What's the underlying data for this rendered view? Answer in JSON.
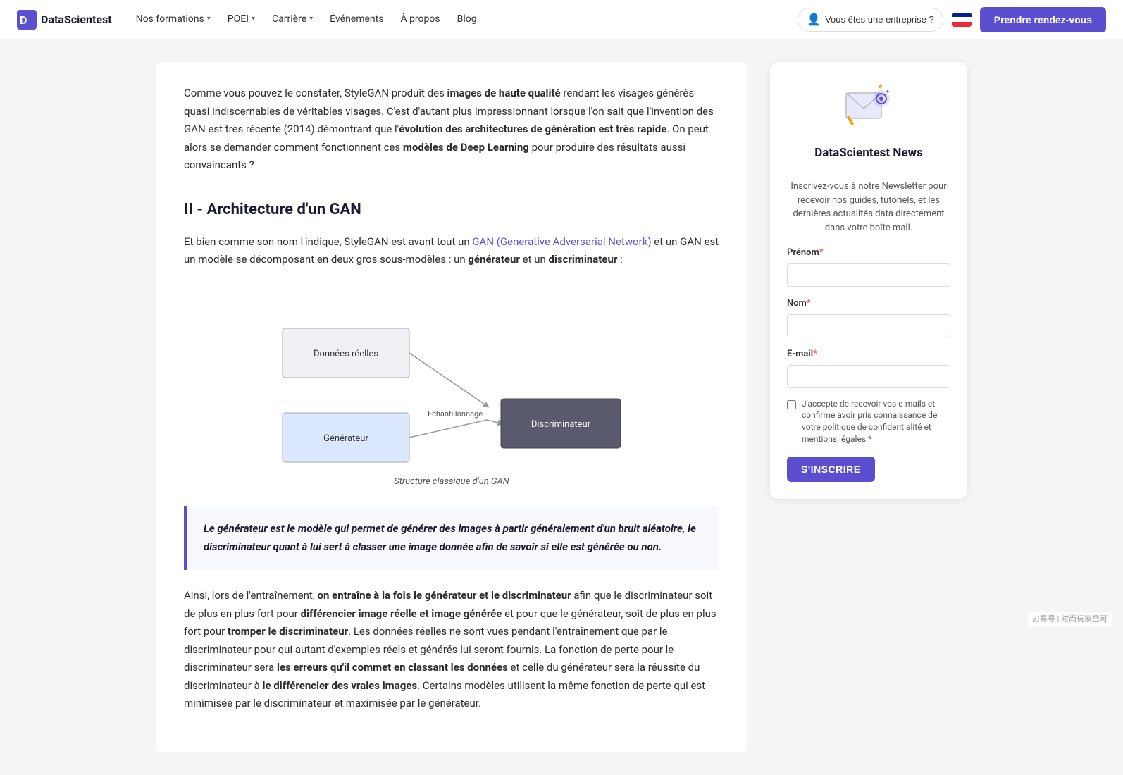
{
  "navbar": {
    "logo_text": "DataScientest",
    "nav_items": [
      {
        "label": "Nos formations",
        "has_dropdown": true
      },
      {
        "label": "POEI",
        "has_dropdown": true
      },
      {
        "label": "Carrière",
        "has_dropdown": true
      },
      {
        "label": "Événements",
        "has_dropdown": false
      },
      {
        "label": "À propos",
        "has_dropdown": false
      },
      {
        "label": "Blog",
        "has_dropdown": false
      }
    ],
    "enterprise_label": "Vous êtes une entreprise ?",
    "cta_label": "Prendre rendez-vous"
  },
  "article": {
    "intro_paragraph": "Comme vous pouvez le constater, StyleGAN produit des images de haute qualité rendant les visages générés quasi indiscernables de véritables visages. C'est d'autant plus impressionnant lorsque l'on sait que l'invention des GAN est très récente (2014) démontrant que l'évolution des architectures de génération est très rapide. On peut alors se demander comment fonctionnent ces modèles de Deep Learning pour produire des résultats aussi convaincants ?",
    "section_heading": "II - Architecture d'un GAN",
    "section_intro": "Et bien comme son nom l'indique, StyleGAN est avant tout un GAN (Generative Adversarial Network) et un GAN est un modèle se décomposant en deux gros sous-modèles : un générateur et un discriminateur :",
    "gan_link_text": "GAN (Generative Adversarial Network)",
    "diagram_caption": "Structure classique d'un GAN",
    "diagram_nodes": {
      "donnees_reelles": "Données réelles",
      "generateur": "Générateur",
      "echantillonnage": "Echantillonnage",
      "discriminateur": "Discriminateur"
    },
    "highlight_text": "Le générateur est le modèle qui permet de générer des images à partir généralement d'un bruit aléatoire, le discriminateur quant à lui sert à classer une image donnée afin de savoir si elle est générée ou non.",
    "body_paragraph": "Ainsi, lors de l'entraînement, on entraîne à la fois le générateur et le discriminateur afin que le discriminateur soit de plus en plus fort pour différencier image réelle et image générée et pour que le générateur, soit de plus en plus fort pour tromper le discriminateur. Les données réelles ne sont vues pendant l'entraînement que par le discriminateur pour qui autant d'exemples réels et générés lui seront fournis. La fonction de perte pour le discriminateur sera les erreurs qu'il commet en classant les données et celle du générateur sera la réussite du discriminateur à le différencier des vraies images. Certains modèles utilisent la même fonction de perte qui est minimisée par le discriminateur et maximisée par le générateur."
  },
  "sidebar": {
    "newsletter_title": "DataScientest News",
    "newsletter_desc": "Inscrivez-vous à notre Newsletter pour recevoir nos guides, tutoriels, et les dernières actualités data directement dans votre boîte mail.",
    "form": {
      "prenom_label": "Prénom",
      "prenom_required": "*",
      "nom_label": "Nom",
      "nom_required": "*",
      "email_label": "E-mail",
      "email_required": "*",
      "checkbox_label": "J'accepte de recevoir vos e-mails et confirme avoir pris connaissance de votre politique de confidentialité et mentions légales.",
      "checkbox_required": "*",
      "submit_label": "S'INSCRIRE"
    }
  },
  "watermark": "刃易号 | 时尚玩家岳可"
}
